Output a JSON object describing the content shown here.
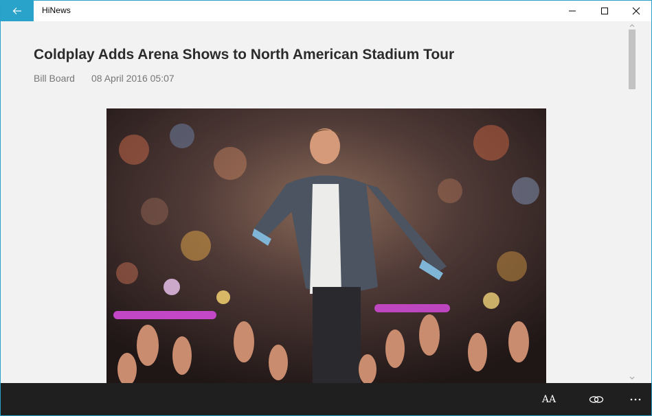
{
  "window": {
    "title": "HiNews",
    "back_icon": "arrow-left-icon",
    "controls": [
      "minimize-icon",
      "maximize-icon",
      "close-icon"
    ],
    "accent_color": "#2aa3cb"
  },
  "article": {
    "title": "Coldplay Adds Arena Shows to North American Stadium Tour",
    "source": "Bill Board",
    "date": "08 April 2016 05:07",
    "image": "singer-performing-on-stage-photo"
  },
  "appbar": {
    "font_size_label": "AA",
    "buttons": [
      "font-size-icon",
      "link-icon",
      "more-icon"
    ]
  }
}
